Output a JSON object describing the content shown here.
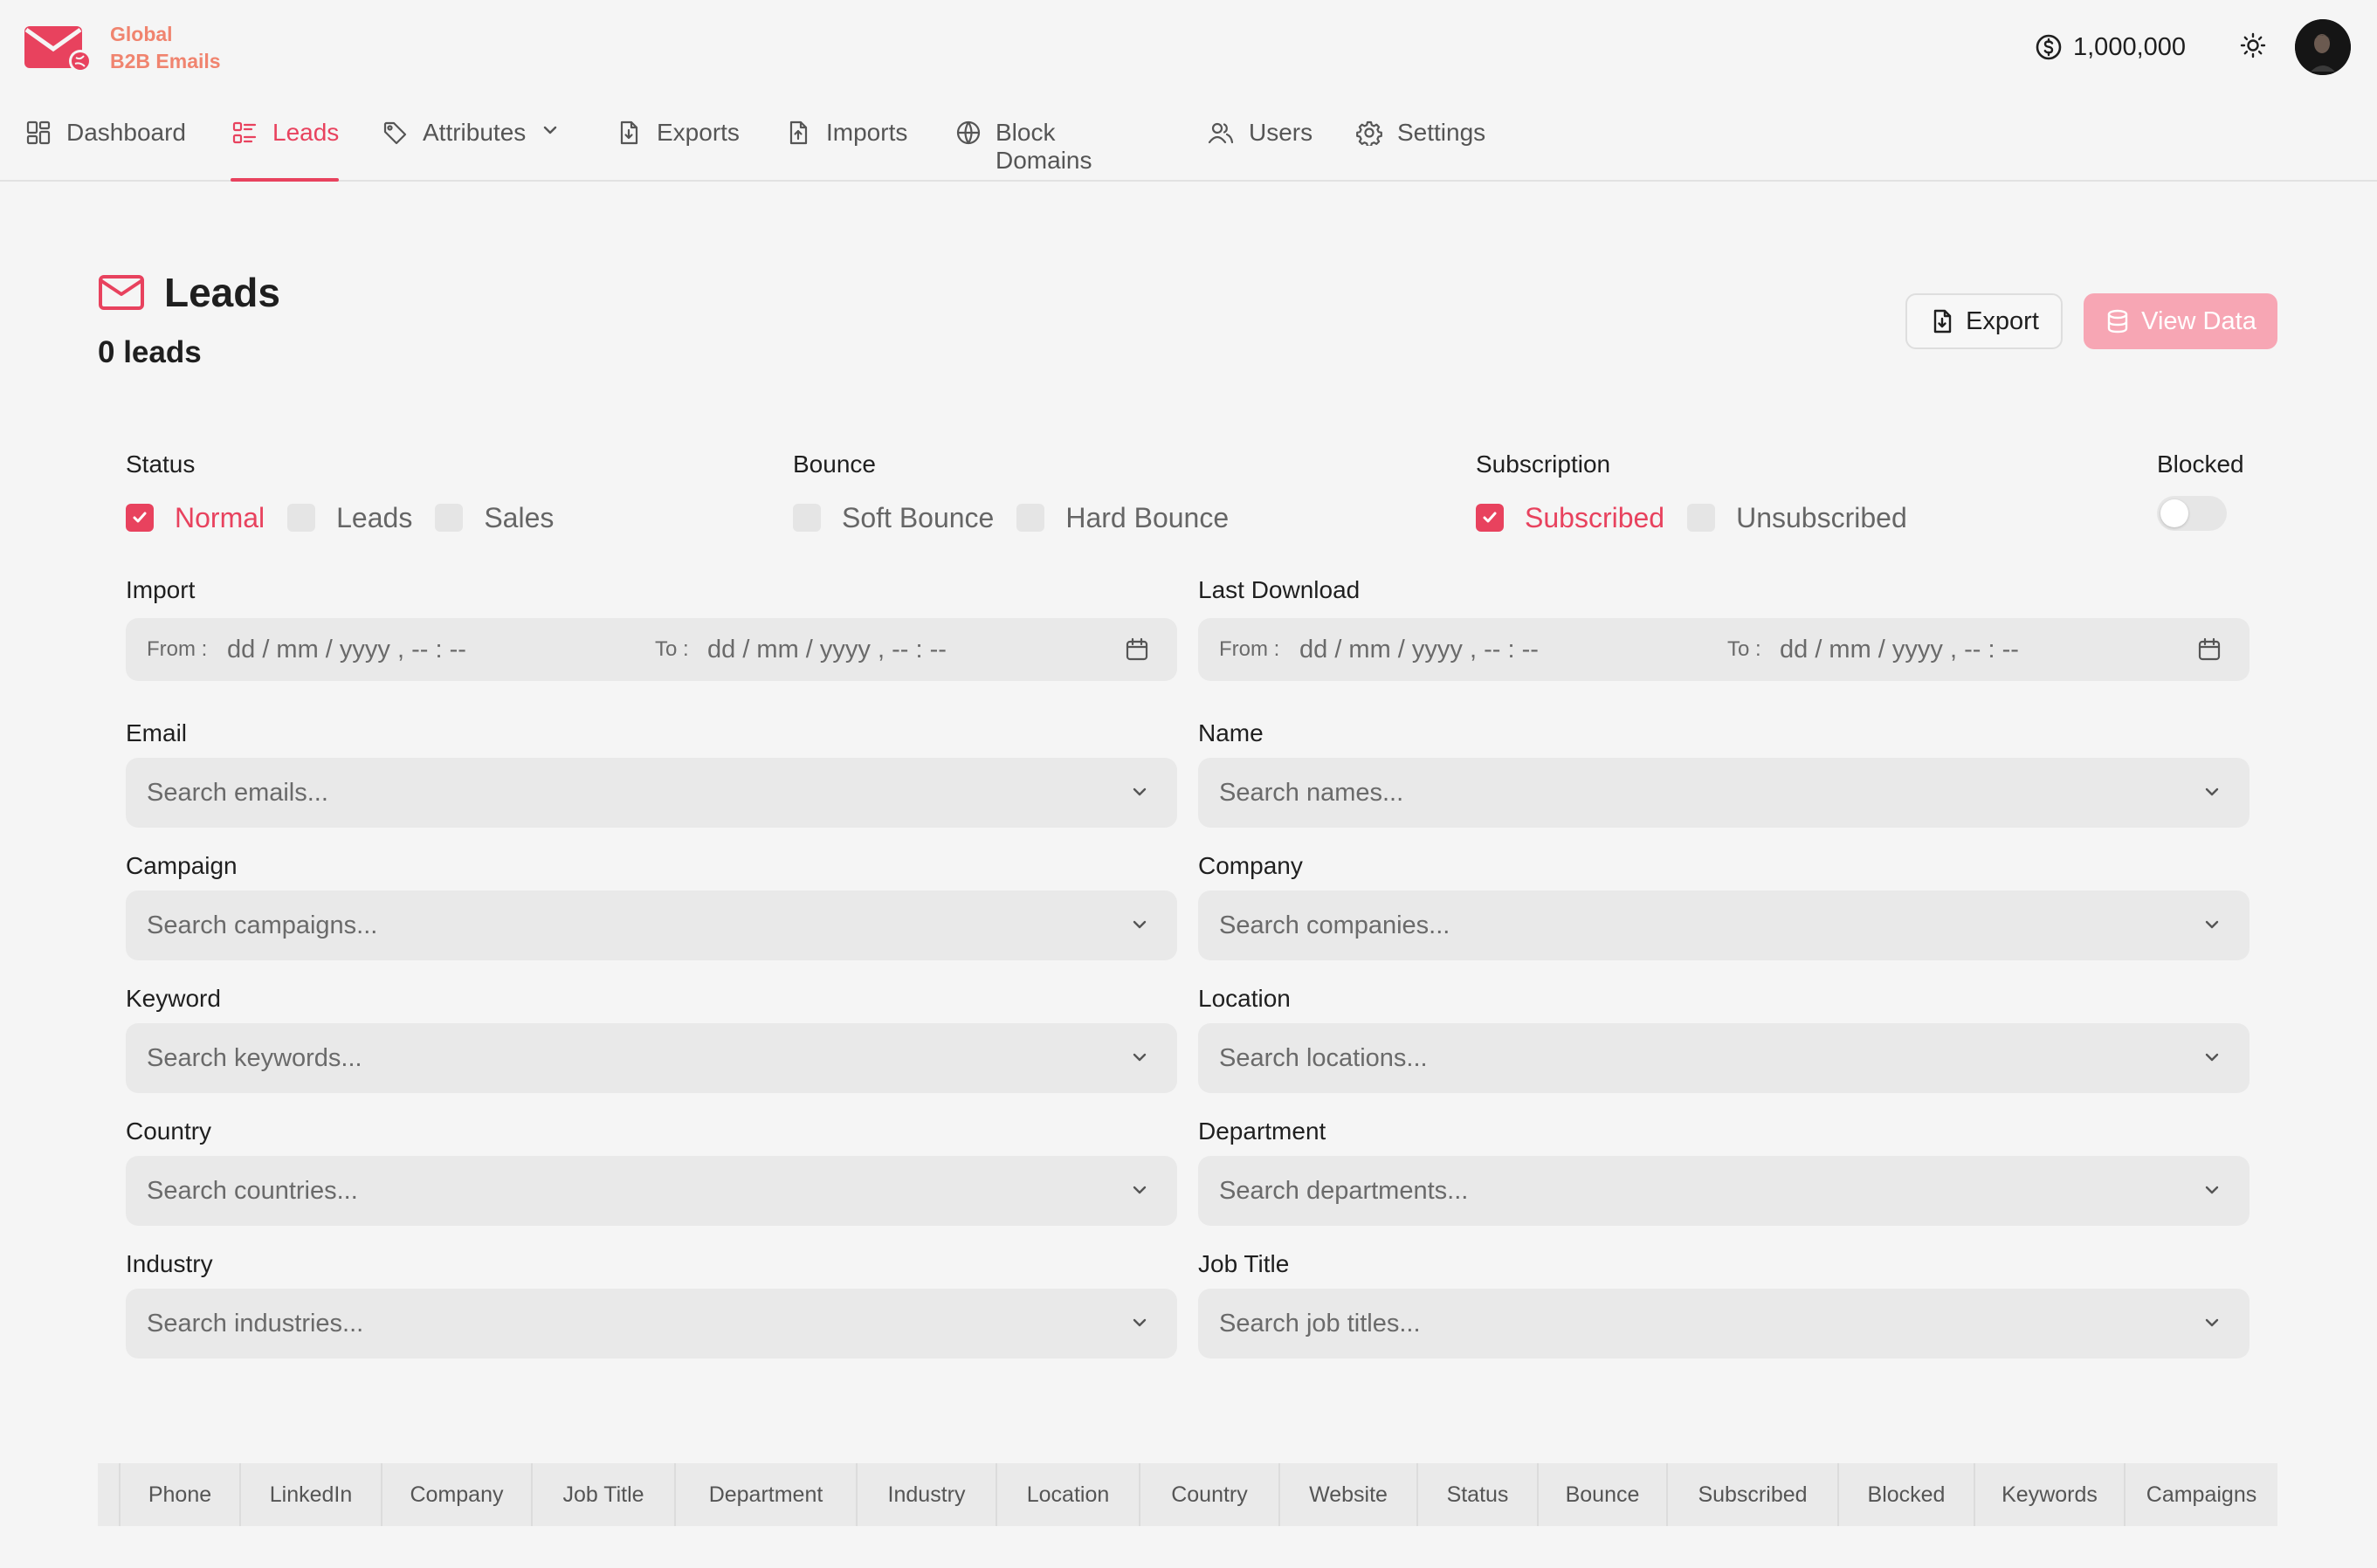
{
  "brand": {
    "line1": "Global",
    "line2": "B2B Emails",
    "color": "#e8425e",
    "logo_icon": "mail-globe-icon"
  },
  "header": {
    "balance": "1,000,000",
    "balance_icon": "dollar-coin-icon",
    "theme_icon": "sun-icon"
  },
  "nav": {
    "items": [
      {
        "label": "Dashboard",
        "icon": "grid-icon"
      },
      {
        "label": "Leads",
        "icon": "list-icon",
        "active": true
      },
      {
        "label": "Attributes",
        "icon": "tag-icon",
        "dropdown": true
      },
      {
        "label": "Exports",
        "icon": "file-download-icon"
      },
      {
        "label": "Imports",
        "icon": "file-upload-icon"
      },
      {
        "label": "Block Domains",
        "icon": "globe-block-icon"
      },
      {
        "label": "Users",
        "icon": "users-icon"
      },
      {
        "label": "Settings",
        "icon": "gear-icon"
      }
    ]
  },
  "page": {
    "title": "Leads",
    "count": "0 leads",
    "export_label": "Export",
    "view_label": "View Data"
  },
  "filters": {
    "status": {
      "label": "Status",
      "options": [
        {
          "label": "Normal",
          "checked": true
        },
        {
          "label": "Leads",
          "checked": false
        },
        {
          "label": "Sales",
          "checked": false
        }
      ]
    },
    "bounce": {
      "label": "Bounce",
      "options": [
        {
          "label": "Soft Bounce",
          "checked": false
        },
        {
          "label": "Hard Bounce",
          "checked": false
        }
      ]
    },
    "subscription": {
      "label": "Subscription",
      "options": [
        {
          "label": "Subscribed",
          "checked": true
        },
        {
          "label": "Unsubscribed",
          "checked": false
        }
      ]
    },
    "blocked": {
      "label": "Blocked",
      "on": false
    },
    "import": {
      "label": "Import",
      "from_label": "From :",
      "to_label": "To :",
      "from_value": "dd / mm / yyyy ,  -- : --",
      "to_value": "dd / mm / yyyy ,  -- : --"
    },
    "last_download": {
      "label": "Last Download",
      "from_label": "From :",
      "to_label": "To :",
      "from_value": "dd / mm / yyyy ,  -- : --",
      "to_value": "dd / mm / yyyy ,  -- : --"
    },
    "selects": [
      {
        "label": "Email",
        "placeholder": "Search emails..."
      },
      {
        "label": "Name",
        "placeholder": "Search names..."
      },
      {
        "label": "Campaign",
        "placeholder": "Search campaigns..."
      },
      {
        "label": "Company",
        "placeholder": "Search companies..."
      },
      {
        "label": "Keyword",
        "placeholder": "Search keywords..."
      },
      {
        "label": "Location",
        "placeholder": "Search locations..."
      },
      {
        "label": "Country",
        "placeholder": "Search countries..."
      },
      {
        "label": "Department",
        "placeholder": "Search departments..."
      },
      {
        "label": "Industry",
        "placeholder": "Search industries..."
      },
      {
        "label": "Job Title",
        "placeholder": "Search job titles..."
      }
    ]
  },
  "table": {
    "columns": [
      "Phone",
      "LinkedIn",
      "Company",
      "Job Title",
      "Department",
      "Industry",
      "Location",
      "Country",
      "Website",
      "Status",
      "Bounce",
      "Subscribed",
      "Blocked",
      "Keywords",
      "Campaigns"
    ]
  }
}
